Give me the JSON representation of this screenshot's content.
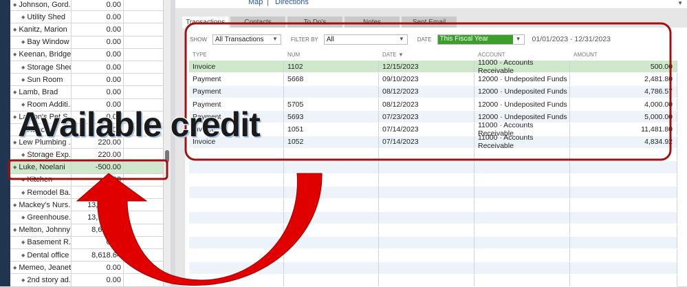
{
  "customers": [
    {
      "name": "Johnson, Gord...",
      "balance": "0.00",
      "sub": false
    },
    {
      "name": "Utility Shed",
      "balance": "0.00",
      "sub": true
    },
    {
      "name": "Kanitz, Marion",
      "balance": "0.00",
      "sub": false
    },
    {
      "name": "Bay Window",
      "balance": "0.00",
      "sub": true
    },
    {
      "name": "Keenan, Bridget",
      "balance": "0.00",
      "sub": false
    },
    {
      "name": "Storage Shed",
      "balance": "0.00",
      "sub": true
    },
    {
      "name": "Sun Room",
      "balance": "0.00",
      "sub": true
    },
    {
      "name": "Lamb, Brad",
      "balance": "0.00",
      "sub": false
    },
    {
      "name": "Room Additi...",
      "balance": "0.00",
      "sub": true
    },
    {
      "name": "Larson's Pet S...",
      "balance": "0.00",
      "sub": false
    },
    {
      "name": "Ranch",
      "balance": "0.00",
      "sub": true
    },
    {
      "name": "Lew Plumbing ...",
      "balance": "220.00",
      "sub": false
    },
    {
      "name": "Storage Exp...",
      "balance": "220.00",
      "sub": true
    },
    {
      "name": "Luke, Noelani",
      "balance": "-500.00",
      "sub": false,
      "selected": true
    },
    {
      "name": "Kitchen",
      "balance": "0.00",
      "sub": true
    },
    {
      "name": "Remodel Ba...",
      "balance": "0.00",
      "sub": true
    },
    {
      "name": "Mackey's Nurs...",
      "balance": "13,900.00",
      "sub": false
    },
    {
      "name": "Greenhouse...",
      "balance": "13,900.00",
      "sub": true
    },
    {
      "name": "Melton, Johnny",
      "balance": "8,618.64",
      "sub": false
    },
    {
      "name": "Basement R...",
      "balance": "0.00",
      "sub": true
    },
    {
      "name": "Dental office",
      "balance": "8,618.64",
      "sub": true
    },
    {
      "name": "Memeo, Jeanette",
      "balance": "0.00",
      "sub": false
    },
    {
      "name": "2nd story ad...",
      "balance": "0.00",
      "sub": true
    }
  ],
  "links": {
    "map": "Map",
    "directions": "Directions"
  },
  "tabs": [
    "Transactions",
    "Contacts",
    "To Do's",
    "Notes",
    "Sent Email"
  ],
  "filters": {
    "show_label": "SHOW",
    "show_value": "All Transactions",
    "filter_label": "FILTER BY",
    "filter_value": "All",
    "date_label": "DATE",
    "date_value": "This Fiscal Year",
    "date_range": "01/01/2023 - 12/31/2023"
  },
  "columns": [
    "TYPE",
    "NUM",
    "DATE ▼",
    "ACCOUNT",
    "AMOUNT"
  ],
  "transactions": [
    {
      "type": "Invoice",
      "num": "1102",
      "date": "12/15/2023",
      "account": "11000 · Accounts Receivable",
      "amount": "500.00"
    },
    {
      "type": "Payment",
      "num": "5668",
      "date": "09/10/2023",
      "account": "12000 · Undeposited Funds",
      "amount": "2,481.80"
    },
    {
      "type": "Payment",
      "num": "",
      "date": "08/12/2023",
      "account": "12000 · Undeposited Funds",
      "amount": "4,786.57"
    },
    {
      "type": "Payment",
      "num": "5705",
      "date": "08/12/2023",
      "account": "12000 · Undeposited Funds",
      "amount": "4,000.00"
    },
    {
      "type": "Payment",
      "num": "5693",
      "date": "07/23/2023",
      "account": "12000 · Undeposited Funds",
      "amount": "5,000.00"
    },
    {
      "type": "Invoice",
      "num": "1051",
      "date": "07/14/2023",
      "account": "11000 · Accounts Receivable",
      "amount": "11,481.80"
    },
    {
      "type": "Invoice",
      "num": "1052",
      "date": "07/14/2023",
      "account": "11000 · Accounts Receivable",
      "amount": "4,834.92"
    }
  ],
  "annotation": "Available credit",
  "colors": {
    "highlight": "#cfe8cc",
    "annotation_red": "#c00000",
    "arrow_red": "#e00000",
    "date_green": "#3aa02a"
  }
}
